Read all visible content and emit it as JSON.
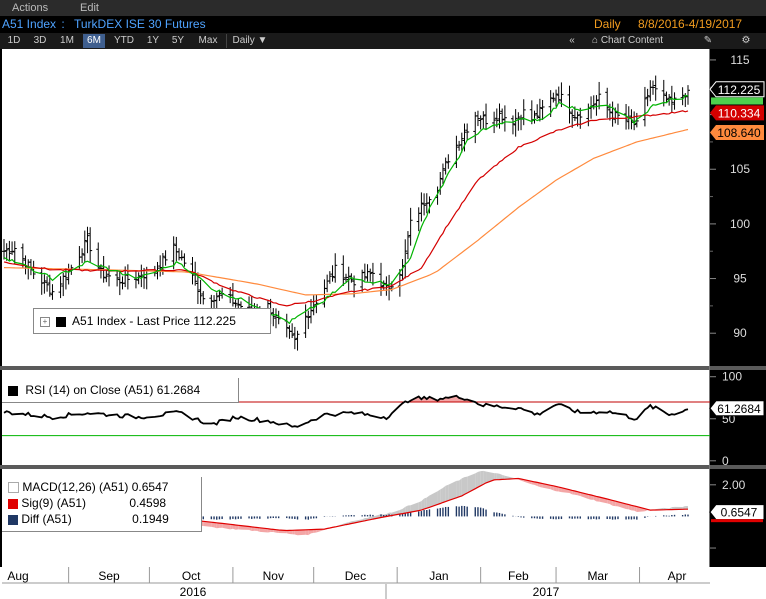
{
  "menu": {
    "actions": "Actions",
    "edit": "Edit"
  },
  "title": {
    "ticker": "A51 Index",
    "separator": " : ",
    "name": "TurkDEX ISE 30 Futures",
    "frequency": "Daily",
    "range": "8/8/2016-4/19/2017"
  },
  "toolbar": {
    "periods": [
      "1D",
      "3D",
      "1M",
      "6M",
      "YTD",
      "1Y",
      "5Y",
      "Max"
    ],
    "active_period": "6M",
    "interval": "Daily",
    "collapse": "«",
    "chart_content": "Chart Content"
  },
  "colors": {
    "bg": "#000000",
    "panel": "#ffffff",
    "price": "#000000",
    "ma_fast": "#00b400",
    "ma_mid": "#d40000",
    "ma_slow": "#ff8a3d",
    "rsi_up": "#c00000",
    "rsi_low": "#00b400",
    "macd": "#000000",
    "signal": "#e00000",
    "diff": "#203864",
    "shade_pos": "#c8c8c8",
    "shade_neg": "#f3a6a6"
  },
  "legend_price": {
    "label": "A51 Index - Last Price",
    "value": "112.225"
  },
  "legend_rsi": {
    "label": "RSI (14) on Close (A51)",
    "value": "61.2684"
  },
  "legend_macd": [
    {
      "label": "MACD(12,26) (A51)",
      "value": "0.6547",
      "color": "#ffffff"
    },
    {
      "label": "Sig(9) (A51)",
      "value": "0.4598",
      "color": "#e00000"
    },
    {
      "label": "Diff (A51)",
      "value": "0.1949",
      "color": "#203864"
    }
  ],
  "last_value_tags": {
    "price": "112.225",
    "ma_mid": "110.334",
    "ma_slow": "108.640",
    "rsi": "61.2684",
    "macd": "0.6547"
  },
  "chart_data": {
    "type": "line",
    "price_axis": {
      "ticks": [
        90,
        95,
        100,
        105,
        110,
        115
      ],
      "ylim": [
        87.0,
        116.0
      ]
    },
    "rsi_axis": {
      "ticks": [
        0,
        50,
        100
      ],
      "ylim": [
        -5,
        108
      ],
      "levels": [
        70,
        30
      ]
    },
    "macd_axis": {
      "ticks": [
        "2.00"
      ],
      "ylim": [
        -3.2,
        3.0
      ]
    },
    "x_months": [
      "Aug",
      "Sep",
      "Oct",
      "Nov",
      "Dec",
      "Jan",
      "Feb",
      "Mar",
      "Apr"
    ],
    "x_years": [
      "2016",
      "2017"
    ],
    "price_anchors": [
      [
        "2016-08-08",
        97.5
      ],
      [
        "2016-08-12",
        97.8
      ],
      [
        "2016-08-19",
        95.5
      ],
      [
        "2016-08-26",
        93.8
      ],
      [
        "2016-09-02",
        96.0
      ],
      [
        "2016-09-08",
        98.5
      ],
      [
        "2016-09-13",
        95.5
      ],
      [
        "2016-09-20",
        94.8
      ],
      [
        "2016-09-27",
        95.2
      ],
      [
        "2016-10-03",
        95.8
      ],
      [
        "2016-10-10",
        97.8
      ],
      [
        "2016-10-14",
        96.5
      ],
      [
        "2016-10-21",
        93.2
      ],
      [
        "2016-10-28",
        93.5
      ],
      [
        "2016-11-04",
        92.5
      ],
      [
        "2016-11-09",
        91.8
      ],
      [
        "2016-11-14",
        92.5
      ],
      [
        "2016-11-18",
        91.0
      ],
      [
        "2016-11-24",
        89.2
      ],
      [
        "2016-11-28",
        91.5
      ],
      [
        "2016-12-02",
        93.0
      ],
      [
        "2016-12-09",
        95.8
      ],
      [
        "2016-12-16",
        94.8
      ],
      [
        "2016-12-23",
        95.5
      ],
      [
        "2016-12-28",
        94.0
      ],
      [
        "2017-01-03",
        96.0
      ],
      [
        "2017-01-06",
        100.0
      ],
      [
        "2017-01-11",
        102.0
      ],
      [
        "2017-01-16",
        103.5
      ],
      [
        "2017-01-20",
        106.0
      ],
      [
        "2017-01-25",
        108.0
      ],
      [
        "2017-01-30",
        110.0
      ],
      [
        "2017-02-03",
        109.5
      ],
      [
        "2017-02-08",
        110.0
      ],
      [
        "2017-02-13",
        109.5
      ],
      [
        "2017-02-17",
        110.2
      ],
      [
        "2017-02-20",
        109.5
      ],
      [
        "2017-02-24",
        110.5
      ],
      [
        "2017-03-01",
        112.0
      ],
      [
        "2017-03-03",
        111.5
      ],
      [
        "2017-03-08",
        110.0
      ],
      [
        "2017-03-13",
        110.5
      ],
      [
        "2017-03-17",
        111.5
      ],
      [
        "2017-03-22",
        110.0
      ],
      [
        "2017-03-27",
        109.5
      ],
      [
        "2017-03-31",
        109.0
      ],
      [
        "2017-04-05",
        112.5
      ],
      [
        "2017-04-10",
        111.5
      ],
      [
        "2017-04-13",
        111.0
      ],
      [
        "2017-04-19",
        112.225
      ]
    ],
    "ma_fast_anchors": [
      [
        "2016-08-08",
        97.0
      ],
      [
        "2016-08-26",
        95.0
      ],
      [
        "2016-09-08",
        96.5
      ],
      [
        "2016-09-27",
        95.0
      ],
      [
        "2016-10-12",
        96.5
      ],
      [
        "2016-10-25",
        94.0
      ],
      [
        "2016-11-10",
        92.5
      ],
      [
        "2016-11-22",
        91.0
      ],
      [
        "2016-12-05",
        93.0
      ],
      [
        "2016-12-15",
        95.0
      ],
      [
        "2016-12-30",
        94.5
      ],
      [
        "2017-01-06",
        97.0
      ],
      [
        "2017-01-13",
        101.5
      ],
      [
        "2017-01-20",
        104.5
      ],
      [
        "2017-01-27",
        107.5
      ],
      [
        "2017-02-03",
        108.8
      ],
      [
        "2017-02-15",
        109.5
      ],
      [
        "2017-02-24",
        109.5
      ],
      [
        "2017-03-02",
        111.0
      ],
      [
        "2017-03-10",
        110.5
      ],
      [
        "2017-03-20",
        110.8
      ],
      [
        "2017-03-30",
        109.3
      ],
      [
        "2017-04-07",
        111.0
      ],
      [
        "2017-04-19",
        111.7
      ]
    ],
    "ma_mid_anchors": [
      [
        "2016-08-08",
        96.5
      ],
      [
        "2016-08-26",
        95.8
      ],
      [
        "2016-09-20",
        95.7
      ],
      [
        "2016-10-15",
        95.8
      ],
      [
        "2016-10-31",
        94.0
      ],
      [
        "2016-11-20",
        92.5
      ],
      [
        "2016-12-02",
        93.0
      ],
      [
        "2016-12-15",
        93.8
      ],
      [
        "2016-12-30",
        94.3
      ],
      [
        "2017-01-10",
        96.0
      ],
      [
        "2017-01-20",
        100.0
      ],
      [
        "2017-01-31",
        104.0
      ],
      [
        "2017-02-15",
        107.0
      ],
      [
        "2017-03-01",
        108.5
      ],
      [
        "2017-03-15",
        109.5
      ],
      [
        "2017-03-31",
        109.8
      ],
      [
        "2017-04-19",
        110.334
      ]
    ],
    "ma_slow_anchors": [
      [
        "2016-08-08",
        96.0
      ],
      [
        "2016-09-15",
        95.8
      ],
      [
        "2016-10-15",
        95.6
      ],
      [
        "2016-11-10",
        94.5
      ],
      [
        "2016-11-28",
        93.5
      ],
      [
        "2016-12-15",
        93.6
      ],
      [
        "2016-12-30",
        94.0
      ],
      [
        "2017-01-15",
        95.5
      ],
      [
        "2017-01-31",
        98.5
      ],
      [
        "2017-02-15",
        101.5
      ],
      [
        "2017-03-01",
        104.0
      ],
      [
        "2017-03-15",
        106.0
      ],
      [
        "2017-03-31",
        107.5
      ],
      [
        "2017-04-19",
        108.64
      ]
    ],
    "rsi_anchors": [
      [
        "2016-08-08",
        58
      ],
      [
        "2016-08-26",
        52
      ],
      [
        "2016-09-08",
        57
      ],
      [
        "2016-09-27",
        52
      ],
      [
        "2016-10-12",
        57
      ],
      [
        "2016-10-24",
        43
      ],
      [
        "2016-11-02",
        52
      ],
      [
        "2016-11-15",
        47
      ],
      [
        "2016-11-24",
        40
      ],
      [
        "2016-12-05",
        55
      ],
      [
        "2016-12-15",
        57
      ],
      [
        "2016-12-28",
        52
      ],
      [
        "2017-01-06",
        74
      ],
      [
        "2017-01-16",
        74
      ],
      [
        "2017-01-25",
        76
      ],
      [
        "2017-02-02",
        66
      ],
      [
        "2017-02-15",
        63
      ],
      [
        "2017-02-22",
        55
      ],
      [
        "2017-03-01",
        67
      ],
      [
        "2017-03-10",
        57
      ],
      [
        "2017-03-20",
        59
      ],
      [
        "2017-03-31",
        50
      ],
      [
        "2017-04-05",
        65
      ],
      [
        "2017-04-12",
        55
      ],
      [
        "2017-04-19",
        61.2684
      ]
    ],
    "macd_anchors": [
      [
        "2016-08-08",
        0.0
      ],
      [
        "2016-08-25",
        -0.3
      ],
      [
        "2016-09-15",
        0.1
      ],
      [
        "2016-10-05",
        -0.1
      ],
      [
        "2016-10-25",
        -0.7
      ],
      [
        "2016-11-15",
        -1.0
      ],
      [
        "2016-11-28",
        -1.2
      ],
      [
        "2016-12-15",
        -0.3
      ],
      [
        "2016-12-31",
        0.3
      ],
      [
        "2017-01-10",
        1.0
      ],
      [
        "2017-01-20",
        2.0
      ],
      [
        "2017-02-01",
        2.9
      ],
      [
        "2017-02-10",
        2.6
      ],
      [
        "2017-02-24",
        1.8
      ],
      [
        "2017-03-05",
        1.5
      ],
      [
        "2017-03-20",
        0.8
      ],
      [
        "2017-03-31",
        0.3
      ],
      [
        "2017-04-10",
        0.5
      ],
      [
        "2017-04-19",
        0.6547
      ]
    ],
    "signal_anchors": [
      [
        "2016-08-08",
        0.0
      ],
      [
        "2016-09-01",
        -0.2
      ],
      [
        "2016-09-20",
        0.0
      ],
      [
        "2016-10-10",
        -0.1
      ],
      [
        "2016-10-31",
        -0.5
      ],
      [
        "2016-11-20",
        -0.9
      ],
      [
        "2016-12-05",
        -0.8
      ],
      [
        "2016-12-25",
        -0.1
      ],
      [
        "2017-01-10",
        0.4
      ],
      [
        "2017-01-25",
        1.3
      ],
      [
        "2017-02-05",
        2.3
      ],
      [
        "2017-02-15",
        2.4
      ],
      [
        "2017-03-01",
        1.9
      ],
      [
        "2017-03-20",
        1.1
      ],
      [
        "2017-04-05",
        0.4
      ],
      [
        "2017-04-19",
        0.4598
      ]
    ]
  }
}
